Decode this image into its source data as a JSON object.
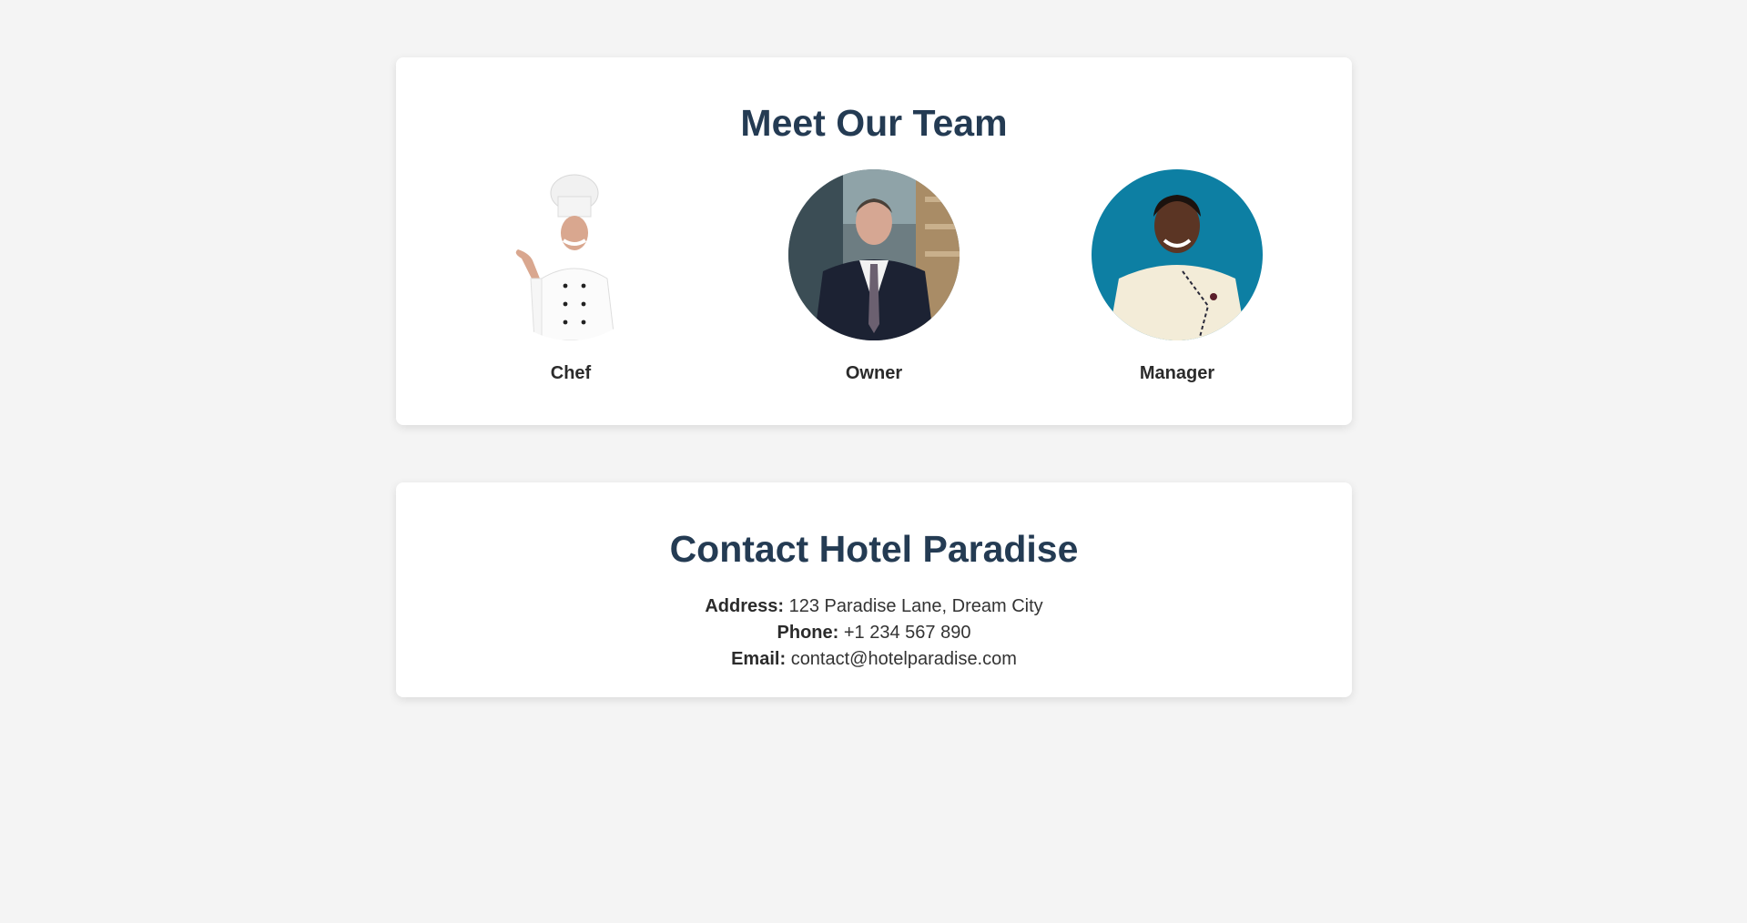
{
  "team": {
    "title": "Meet Our Team",
    "members": [
      {
        "role": "Chef",
        "photo_icon": "chef-photo"
      },
      {
        "role": "Owner",
        "photo_icon": "owner-photo"
      },
      {
        "role": "Manager",
        "photo_icon": "manager-photo"
      }
    ]
  },
  "contact": {
    "title": "Contact Hotel Paradise",
    "address_label": "Address:",
    "address_value": "123 Paradise Lane, Dream City",
    "phone_label": "Phone:",
    "phone_value": "+1 234 567 890",
    "email_label": "Email:",
    "email_value": "contact@hotelparadise.com"
  },
  "colors": {
    "page_background": "#f4f4f4",
    "card_background": "#ffffff",
    "heading": "#243b53",
    "manager_photo_bg": "#0d7fa3"
  }
}
